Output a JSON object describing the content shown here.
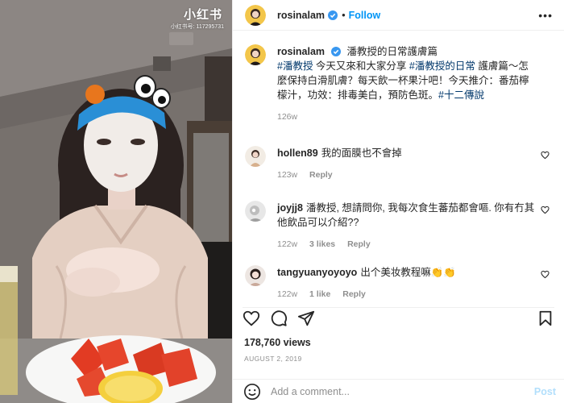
{
  "media": {
    "watermark_logo": "小红书",
    "watermark_id": "小红书号: 117295731"
  },
  "post": {
    "username": "rosinalam",
    "follow_label": "Follow",
    "more_label": "•••",
    "caption": {
      "username": "rosinalam",
      "text_before": " 潘教授的日常護膚篇",
      "tag1": "#潘教授",
      "text_mid1": " 今天又來和大家分享",
      "tag2": "#潘教授的日常",
      "text_mid2": " 護膚篇～怎麼保持白滑肌膚？每天飲一杯果汁吧！今天推介：番茄檸檬汁，功效：排毒美白，預防色斑。",
      "tag3": "#十二傳說",
      "time": "126w"
    },
    "comments": [
      {
        "username": "hollen89",
        "text": "我的面膜也不會掉",
        "time": "123w",
        "likes": "",
        "reply": "Reply"
      },
      {
        "username": "joyjj8",
        "text": "潘教授, 想請問你, 我每次食生蕃茄都會嘔. 你有冇其他飲品可以介紹??",
        "time": "122w",
        "likes": "3 likes",
        "reply": "Reply"
      },
      {
        "username": "tangyuanyoyoyo",
        "text": "出个美妆教程嘛👏👏",
        "time": "122w",
        "likes": "1 like",
        "reply": "Reply"
      }
    ],
    "views": "178,760 views",
    "date": "AUGUST 2, 2019",
    "add_comment_placeholder": "Add a comment...",
    "post_label": "Post"
  },
  "icons": [
    "verified-badge-icon",
    "heart-icon",
    "comment-icon",
    "share-icon",
    "bookmark-icon",
    "emoji-icon"
  ],
  "colors": {
    "link_blue": "#0095f6",
    "tag_blue": "#00376b",
    "muted": "#8e8e8e",
    "post_disabled": "#b2dffc"
  }
}
